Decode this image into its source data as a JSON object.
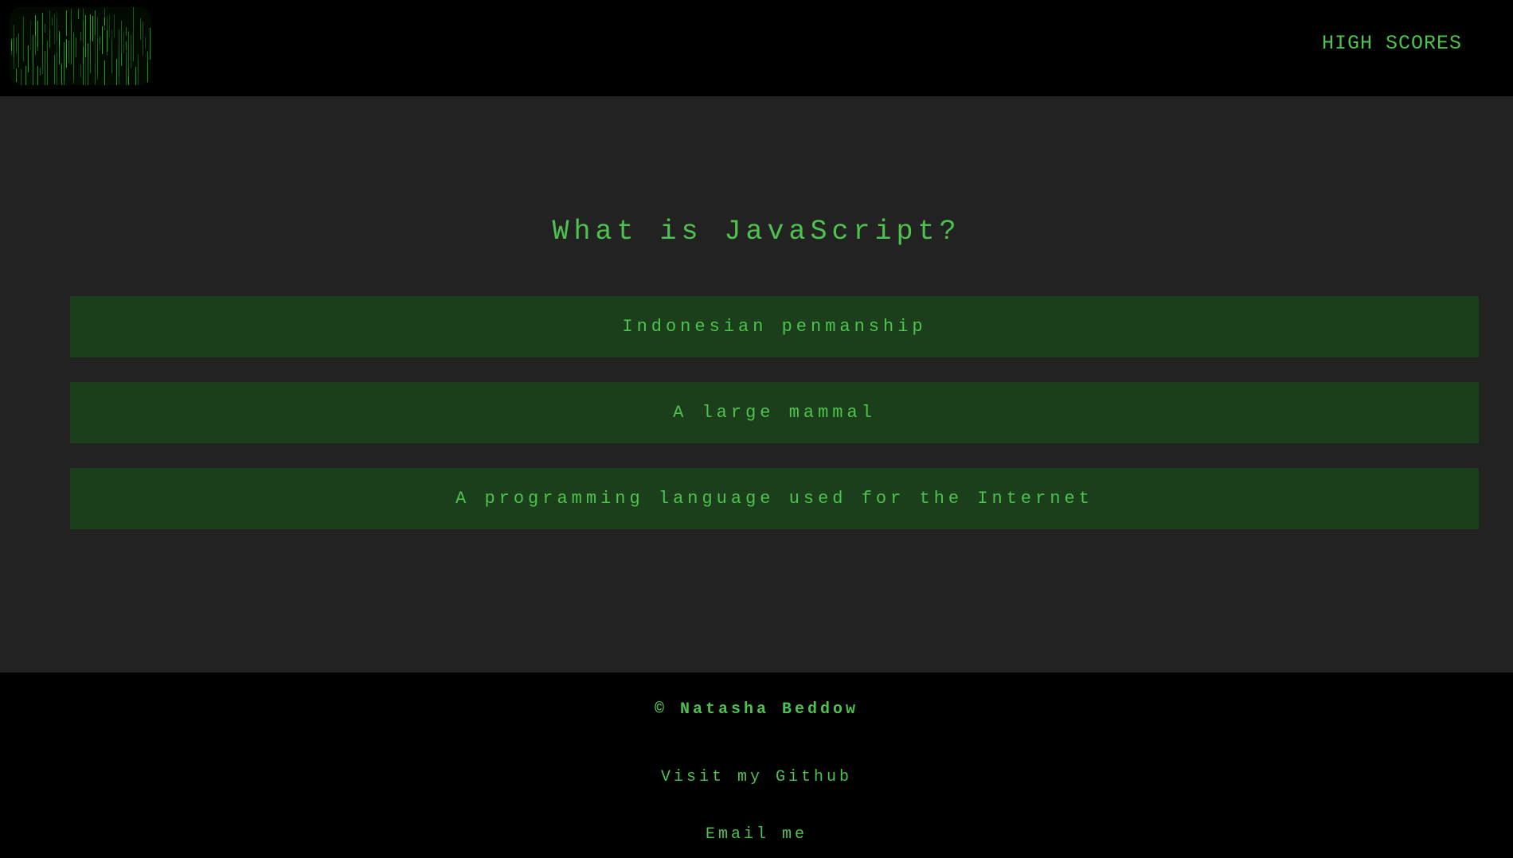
{
  "header": {
    "logo_icon": "matrix-code-rain-icon",
    "nav_high_scores": "HIGH SCORES"
  },
  "quiz": {
    "question": "What is JavaScript?",
    "answers": [
      "Indonesian penmanship",
      "A large mammal",
      "A programming language used for the Internet"
    ]
  },
  "footer": {
    "copyright": "© Natasha Beddow",
    "github_link": "Visit my Github",
    "email_link": "Email me"
  },
  "colors": {
    "accent_green": "#4ec24e",
    "button_bg": "#1b3f1b",
    "main_bg": "#222222",
    "header_footer_bg": "#000000"
  }
}
